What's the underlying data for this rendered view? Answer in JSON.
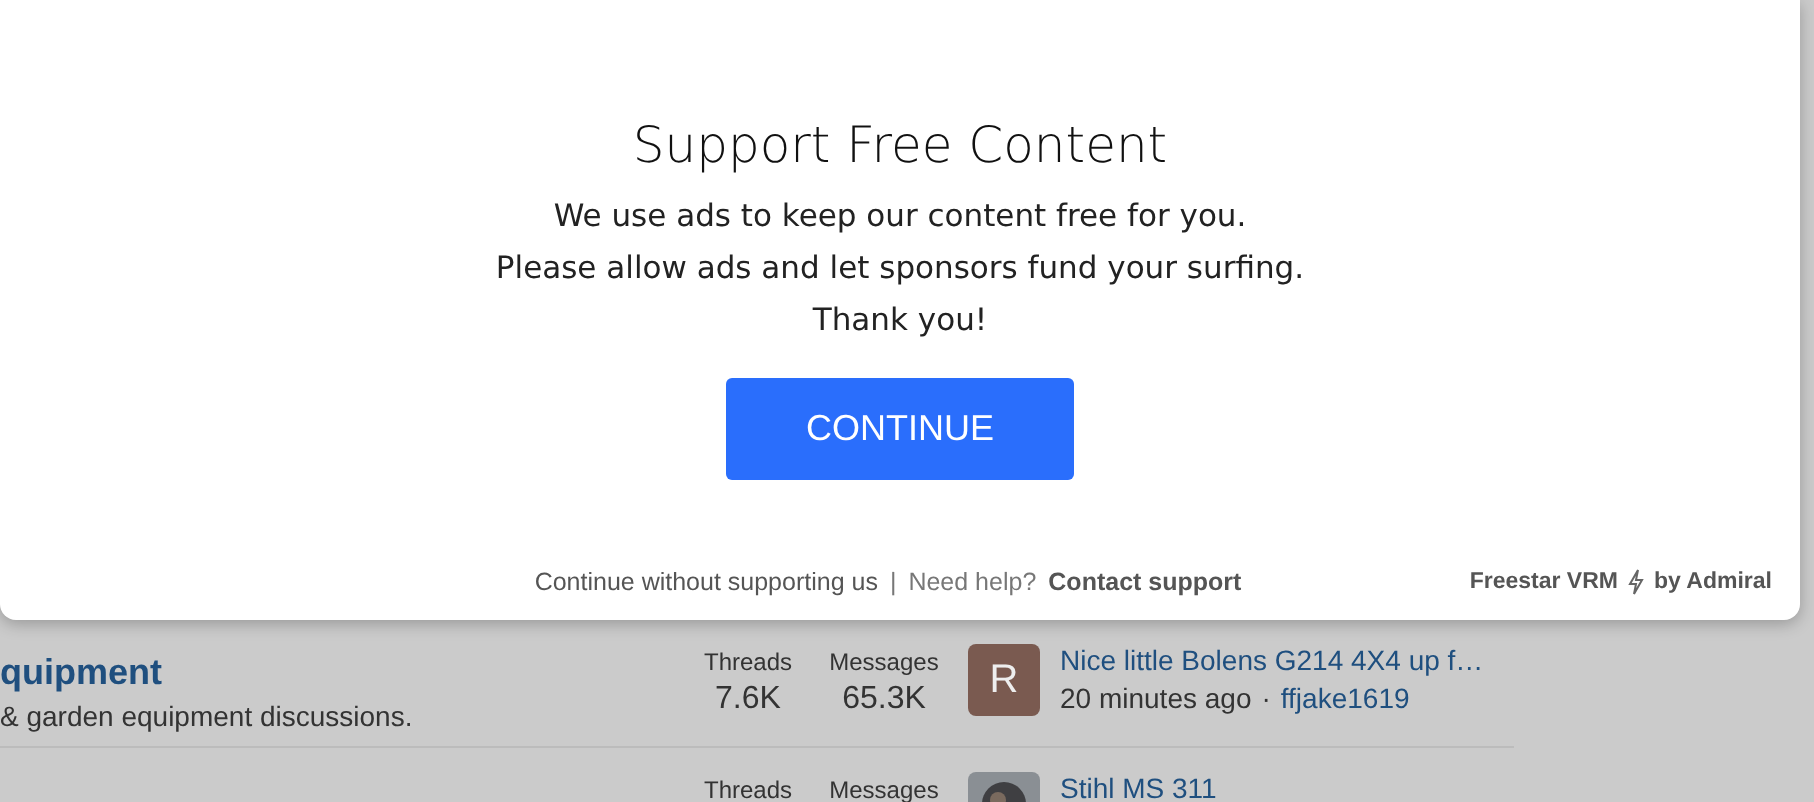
{
  "modal": {
    "title": "Support Free Content",
    "lines": [
      "We use ads to keep our content free for you.",
      "Please allow ads and let sponsors fund your surfing.",
      "Thank you!"
    ],
    "button": "CONTINUE",
    "footer": {
      "skip_link": "Continue without supporting us",
      "separator": "|",
      "help_label": "Need help?",
      "contact_link": "Contact support",
      "brand": "Freestar VRM",
      "by": "by Admiral"
    }
  },
  "forums": [
    {
      "title": "quipment",
      "description": "& garden equipment discussions.",
      "stats": [
        {
          "label": "Threads",
          "value": "7.6K"
        },
        {
          "label": "Messages",
          "value": "65.3K"
        }
      ],
      "latest": {
        "avatar": {
          "kind": "letter",
          "letter": "R",
          "color": "#7a5a50"
        },
        "title": "Nice little Bolens G214 4X4 up f…",
        "time": "20 minutes ago",
        "separator": "·",
        "user": "ffjake1619"
      }
    },
    {
      "stats": [
        {
          "label": "Threads"
        },
        {
          "label": "Messages"
        }
      ],
      "latest": {
        "title": "Stihl MS 311"
      }
    }
  ]
}
